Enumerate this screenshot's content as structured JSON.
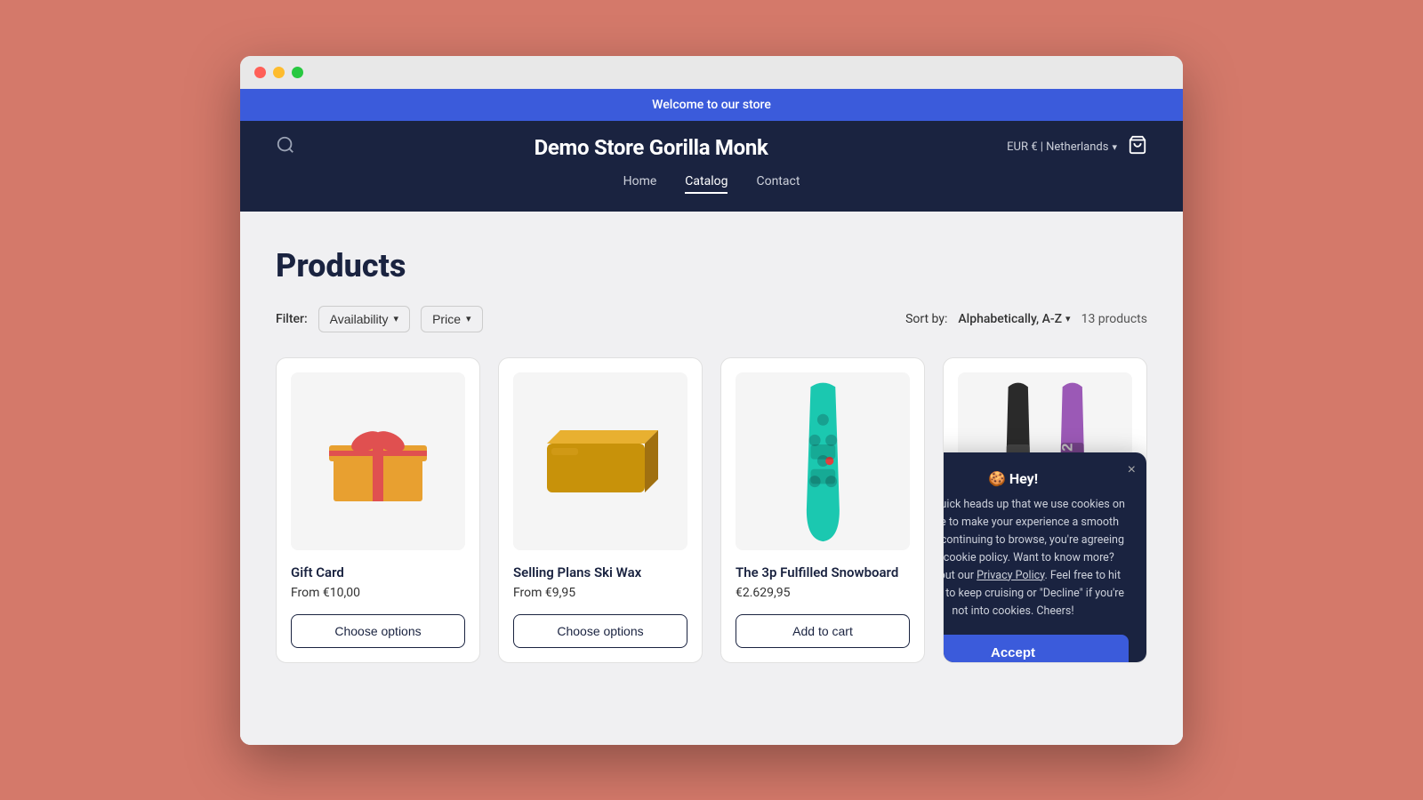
{
  "browser": {
    "traffic_lights": [
      "red",
      "yellow",
      "green"
    ]
  },
  "announcement": {
    "text": "Welcome to our store"
  },
  "header": {
    "title": "Demo Store Gorilla Monk",
    "currency": "EUR € | Netherlands",
    "nav": [
      {
        "label": "Home",
        "active": false
      },
      {
        "label": "Catalog",
        "active": true
      },
      {
        "label": "Contact",
        "active": false
      }
    ]
  },
  "main": {
    "page_title": "Products",
    "filter_label": "Filter:",
    "filters": [
      {
        "label": "Availability",
        "has_chevron": true
      },
      {
        "label": "Price",
        "has_chevron": true
      }
    ],
    "sort_label": "Sort by:",
    "sort_value": "Alphabetically, A-Z",
    "products_count": "13 products",
    "products": [
      {
        "id": "gift-card",
        "name": "Gift Card",
        "price": "From €10,00",
        "button": "Choose options",
        "button_type": "choose"
      },
      {
        "id": "ski-wax",
        "name": "Selling Plans Ski Wax",
        "price": "From €9,95",
        "button": "Choose options",
        "button_type": "choose"
      },
      {
        "id": "snowboard-3p",
        "name": "The 3p Fulfilled Snowboard",
        "price": "€2.629,95",
        "button": "Add to cart",
        "button_type": "cart"
      },
      {
        "id": "snowboard-4",
        "name": "",
        "price": "",
        "button": "",
        "button_type": "none"
      }
    ]
  },
  "cookie": {
    "hey_label": "Hey!",
    "emoji": "🍪",
    "text": "Just a quick heads up that we use cookies on this site to make your experience a smooth one. By continuing to browse, you're agreeing to our cookie policy. Want to know more? Check out our",
    "policy_link": "Privacy Policy",
    "text2": ". Feel free to hit \"Accept\" to keep cruising or \"Decline\" if you're not into cookies. Cheers!",
    "accept_label": "Accept",
    "close_label": "×"
  }
}
